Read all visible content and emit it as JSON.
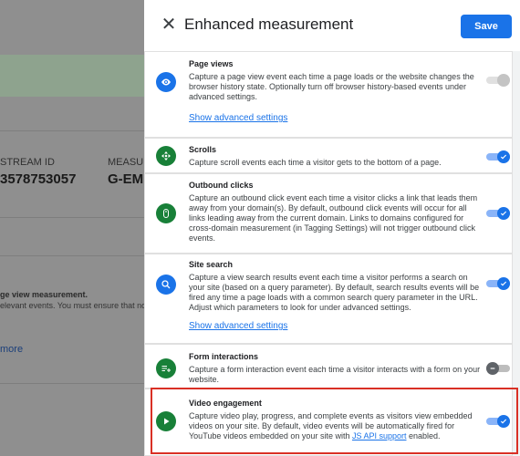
{
  "background": {
    "stream_id_label": "STREAM ID",
    "stream_id_value": "3578753057",
    "measurement_label": "MEASUR",
    "measurement_value": "G-EMP",
    "text_line1": "ge view measurement.",
    "text_line2": "elevant events. You must ensure that no",
    "more_link": "more"
  },
  "drawer": {
    "title": "Enhanced measurement",
    "save_label": "Save",
    "close_icon": "close-icon",
    "advanced_label": "Show advanced settings",
    "cards": [
      {
        "title": "Page views",
        "icon": "eye-icon",
        "color": "#1a73e8",
        "state": "disabled-on",
        "desc": "Capture a page view event each time a page loads or the website changes the browser history state. Optionally turn off browser history-based events under advanced settings."
      },
      {
        "title": "Scrolls",
        "icon": "scroll-icon",
        "color": "#188038",
        "state": "on",
        "desc": "Capture scroll events each time a visitor gets to the bottom of a page."
      },
      {
        "title": "Outbound clicks",
        "icon": "mouse-icon",
        "color": "#188038",
        "state": "on",
        "desc": "Capture an outbound click event each time a visitor clicks a link that leads them away from your domain(s). By default, outbound click events will occur for all links leading away from the current domain. Links to domains configured for cross-domain measurement (in Tagging Settings) will not trigger outbound click events."
      },
      {
        "title": "Site search",
        "icon": "search-icon",
        "color": "#1a73e8",
        "state": "on",
        "desc": "Capture a view search results event each time a visitor performs a search on your site (based on a query parameter). By default, search results events will be fired any time a page loads with a common search query parameter in the URL. Adjust which parameters to look for under advanced settings."
      },
      {
        "title": "Form interactions",
        "icon": "form-icon",
        "color": "#188038",
        "state": "off",
        "desc": "Capture a form interaction event each time a visitor interacts with a form on your website."
      },
      {
        "title": "Video engagement",
        "icon": "play-icon",
        "color": "#188038",
        "state": "on",
        "desc_before": "Capture video play, progress, and complete events as visitors view embedded videos on your site. By default, video events will be automatically fired for YouTube videos embedded on your site with ",
        "desc_link": "JS API support",
        "desc_after": " enabled."
      }
    ]
  }
}
